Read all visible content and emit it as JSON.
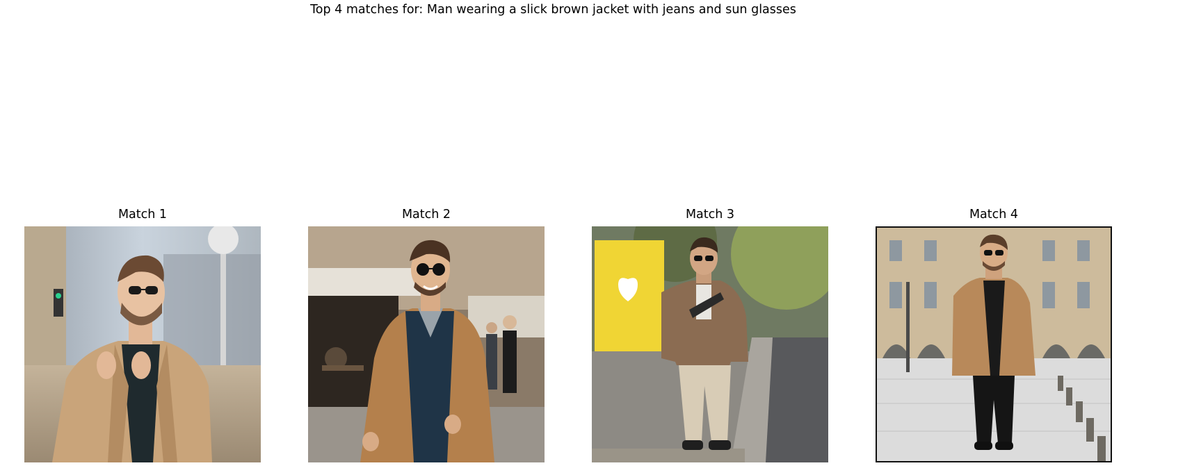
{
  "figure": {
    "suptitle": "Top 4 matches for: Man wearing a slick brown jacket with jeans and sun glasses"
  },
  "matches": [
    {
      "title": "Match 1",
      "image": "man-in-camel-coat-black-turtleneck-sunglasses-street"
    },
    {
      "title": "Match 2",
      "image": "smiling-man-in-brown-coat-blue-vest-sunglasses-cafe-street"
    },
    {
      "title": "Match 3",
      "image": "man-in-plaid-blazer-beige-trousers-sunglasses-sidewalk"
    },
    {
      "title": "Match 4",
      "image": "man-in-camel-coat-black-trousers-sunglasses-plaza"
    }
  ],
  "colors": {
    "background": "#ffffff",
    "text": "#000000",
    "camel": "#b8895a",
    "image_frame": "#111111"
  }
}
